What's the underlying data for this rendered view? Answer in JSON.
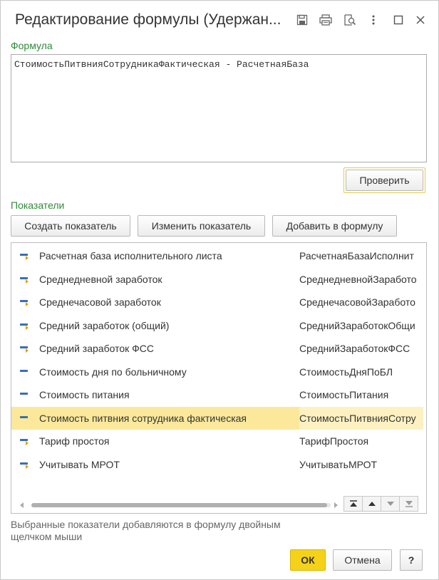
{
  "window": {
    "title": "Редактирование формулы (Удержан..."
  },
  "formula": {
    "label": "Формула",
    "value": "СтоимостьПитвнияСотрудникаФактическая - РасчетнаяБаза"
  },
  "buttons": {
    "check": "Проверить",
    "create": "Создать показатель",
    "edit": "Изменить показатель",
    "add": "Добавить в формулу",
    "ok": "ОК",
    "cancel": "Отмена",
    "help": "?"
  },
  "indicators": {
    "label": "Показатели",
    "rows": [
      {
        "name": "Расчетная база исполнительного листа",
        "code": "РасчетнаяБазаИсполнит",
        "icon": "indicator-param-icon",
        "selected": false
      },
      {
        "name": "Среднедневной заработок",
        "code": "СреднедневнойЗаработо",
        "icon": "indicator-param-icon",
        "selected": false
      },
      {
        "name": "Среднечасовой заработок",
        "code": "СреднечасовойЗаработо",
        "icon": "indicator-param-icon",
        "selected": false
      },
      {
        "name": "Средний заработок (общий)",
        "code": "СреднийЗаработокОбщи",
        "icon": "indicator-param-icon",
        "selected": false
      },
      {
        "name": "Средний заработок ФСС",
        "code": "СреднийЗаработокФСС",
        "icon": "indicator-param-icon",
        "selected": false
      },
      {
        "name": "Стоимость дня по больничному",
        "code": "СтоимостьДняПоБЛ",
        "icon": "indicator-icon",
        "selected": false
      },
      {
        "name": "Стоимость питания",
        "code": "СтоимостьПитания",
        "icon": "indicator-icon",
        "selected": false
      },
      {
        "name": "Стоимость питвния сотрудника фактическая",
        "code": "СтоимостьПитвнияСотру",
        "icon": "indicator-icon",
        "selected": true
      },
      {
        "name": "Тариф простоя",
        "code": "ТарифПростоя",
        "icon": "indicator-param-icon",
        "selected": false
      },
      {
        "name": "Учитывать МРОТ",
        "code": "УчитыватьМРОТ",
        "icon": "indicator-param-icon",
        "selected": false
      }
    ]
  },
  "hint": "Выбранные показатели добавляются в формулу двойным щелчком мыши",
  "colors": {
    "accent_green": "#2e8b3a",
    "selection": "#fbe89b",
    "ok_button": "#f5d21a",
    "icon_blue": "#3c6fb0"
  }
}
